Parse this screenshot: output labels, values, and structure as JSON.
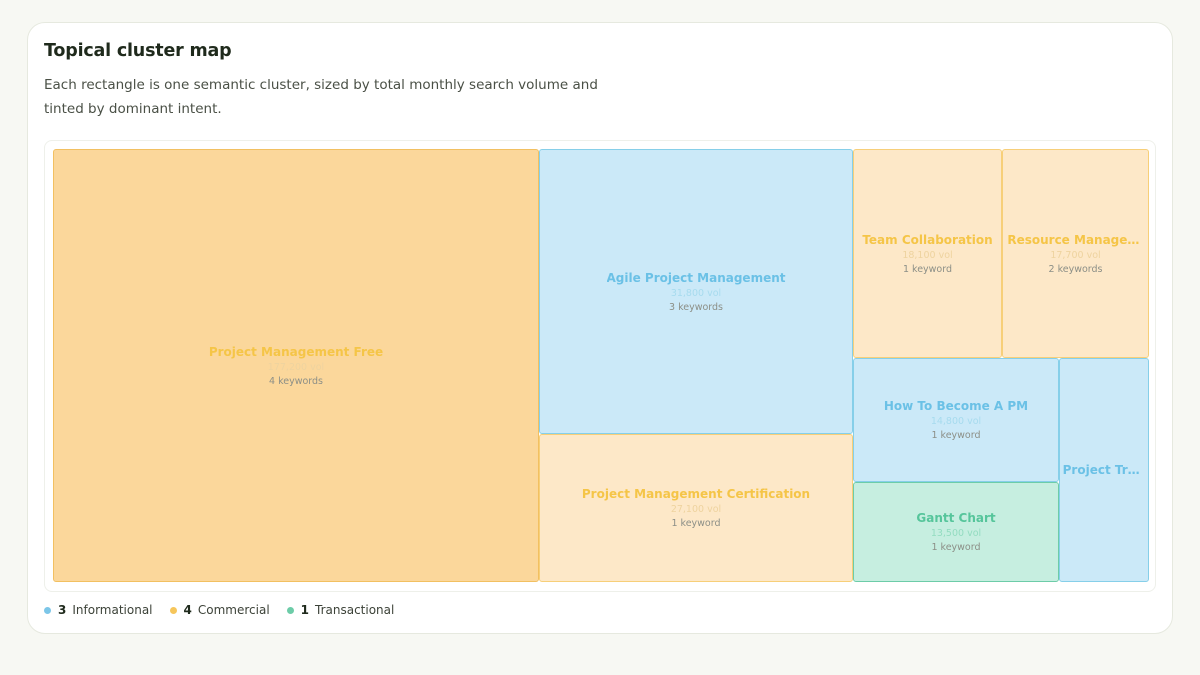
{
  "header": {
    "title": "Topical cluster map",
    "subtitle": "Each rectangle is one semantic cluster, sized by total monthly search volume and tinted by dominant intent."
  },
  "chart_data": {
    "type": "treemap",
    "value_metric": "total monthly search volume",
    "color_by": "dominant intent",
    "clusters": [
      {
        "name": "Project Management Free",
        "volume": 177200,
        "volume_label": "177,200 vol",
        "keywords": 4,
        "keywords_label": "4 keywords",
        "intent": "commercial"
      },
      {
        "name": "Agile Project Management",
        "volume": 31800,
        "volume_label": "31,800 vol",
        "keywords": 3,
        "keywords_label": "3 keywords",
        "intent": "informational"
      },
      {
        "name": "Project Management Certification",
        "volume": 27100,
        "volume_label": "27,100 vol",
        "keywords": 1,
        "keywords_label": "1 keyword",
        "intent": "commercial"
      },
      {
        "name": "Team Collaboration",
        "volume": 18100,
        "volume_label": "18,100 vol",
        "keywords": 1,
        "keywords_label": "1 keyword",
        "intent": "commercial"
      },
      {
        "name": "Resource Management",
        "volume": 17700,
        "volume_label": "17,700 vol",
        "keywords": 2,
        "keywords_label": "2 keywords",
        "intent": "commercial"
      },
      {
        "name": "How To Become A PM",
        "volume": 14800,
        "volume_label": "14,800 vol",
        "keywords": 1,
        "keywords_label": "1 keyword",
        "intent": "informational"
      },
      {
        "name": "Gantt Chart",
        "volume": 13500,
        "volume_label": "13,500 vol",
        "keywords": 1,
        "keywords_label": "1 keyword",
        "intent": "transactional"
      },
      {
        "name": "Project Trac…",
        "intent": "informational"
      }
    ],
    "legend": [
      {
        "count": "3",
        "label": "Informational",
        "color": "#7cc6e8"
      },
      {
        "count": "4",
        "label": "Commercial",
        "color": "#f6c65b"
      },
      {
        "count": "1",
        "label": "Transactional",
        "color": "#6dcca8"
      }
    ]
  }
}
